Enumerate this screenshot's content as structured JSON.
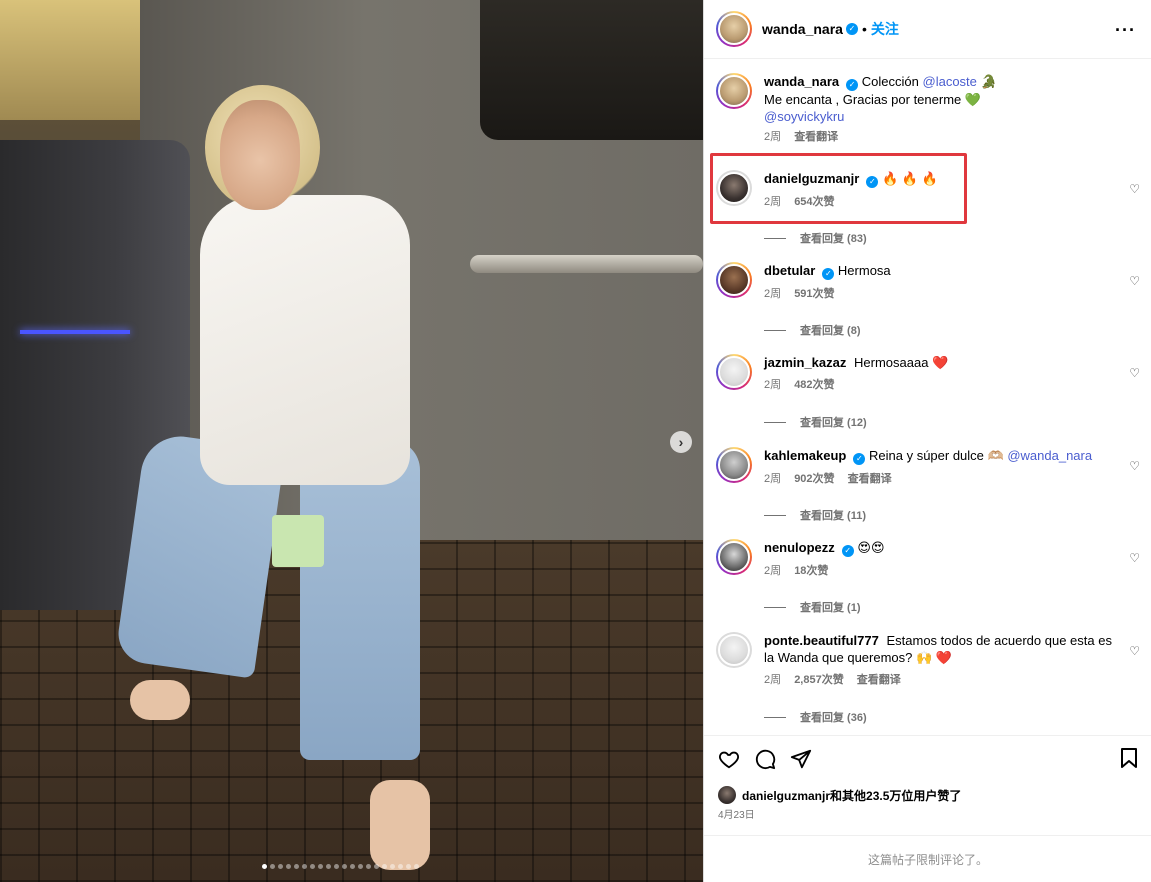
{
  "header": {
    "username": "wanda_nara",
    "separator": "•",
    "follow_label": "关注",
    "more_label": "···"
  },
  "caption": {
    "username": "wanda_nara",
    "text_1": "Colección",
    "mention_1": "@lacoste",
    "emoji_1": "🐊",
    "text_2": "Me encanta , Gracias por tenerme",
    "emoji_2": "💚",
    "mention_2": "@soyvickykru",
    "time": "2周",
    "translate": "查看翻译"
  },
  "comments": [
    {
      "username": "danielguzmanjr",
      "text": "🔥 🔥 🔥",
      "time": "2周",
      "likes": "654次赞",
      "replies": "查看回复 (83)"
    },
    {
      "username": "dbetular",
      "text": "Hermosa",
      "time": "2周",
      "likes": "591次赞",
      "replies": "查看回复 (8)"
    },
    {
      "username": "jazmin_kazaz",
      "text": "Hermosaaaa ❤️",
      "time": "2周",
      "likes": "482次赞",
      "replies": "查看回复 (12)"
    },
    {
      "username": "kahlemakeup",
      "text": "Reina y súper dulce 🫶🏼",
      "mention": "@wanda_nara",
      "time": "2周",
      "likes": "902次赞",
      "translate": "查看翻译",
      "replies": "查看回复 (11)"
    },
    {
      "username": "nenulopezz",
      "text": "😍😍",
      "time": "2周",
      "likes": "18次赞",
      "replies": "查看回复 (1)"
    },
    {
      "username": "ponte.beautiful777",
      "text": "Estamos todos de acuerdo que esta es la Wanda que queremos? 🙌 ❤️",
      "time": "2周",
      "likes": "2,857次赞",
      "translate": "查看翻译",
      "replies": "查看回复 (36)"
    }
  ],
  "actions": {
    "liked_by": "danielguzmanjr和其他23.5万位用户赞了",
    "date": "4月23日"
  },
  "footer": {
    "notice": "这篇帖子限制评论了。"
  },
  "carousel": {
    "next_label": "›",
    "dot_count": 20,
    "active_index": 0
  },
  "colors": {
    "accent": "#0095f6",
    "highlight_box": "#e0383e"
  }
}
